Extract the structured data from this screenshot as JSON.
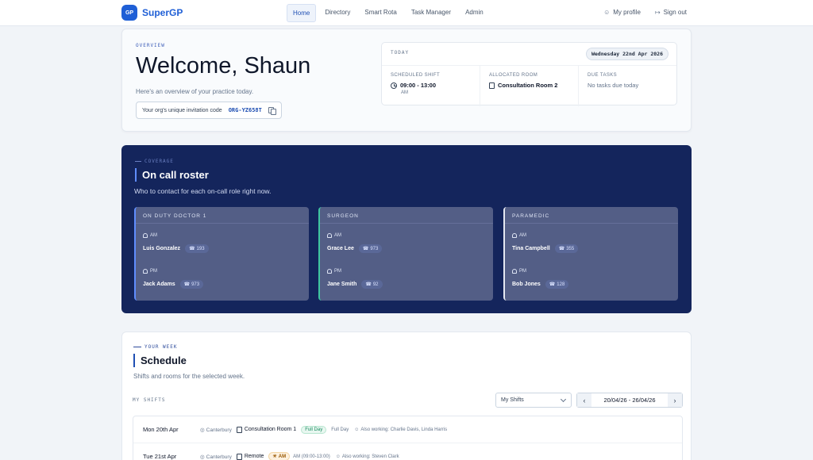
{
  "nav": {
    "logo_badge": "GP",
    "brand": "SuperGP",
    "links": [
      "Home",
      "Directory",
      "Smart Rota",
      "Task Manager",
      "Admin"
    ],
    "my_profile": "My profile",
    "sign_out": "Sign out"
  },
  "overview": {
    "eyebrow": "OVERVIEW",
    "welcome": "Welcome, Shaun",
    "subtitle": "Here's an overview of your practice today.",
    "invite_label": "Your org's unique invitation code",
    "invite_code": "ORG-YZ658T"
  },
  "today": {
    "heading": "TODAY",
    "date": "Wednesday 22nd Apr 2026",
    "scheduled_label": "SCHEDULED SHIFT",
    "scheduled_time": "09:00 - 13:00",
    "scheduled_period": "AM",
    "room_label": "ALLOCATED ROOM",
    "room_value": "Consultation Room 2",
    "tasks_label": "DUE TASKS",
    "tasks_value": "No tasks due today"
  },
  "roster": {
    "eyebrow": "COVERAGE",
    "title": "On call roster",
    "subtitle": "Who to contact for each on-call role right now.",
    "roles": [
      {
        "title": "ON DUTY DOCTOR 1",
        "am_label": "AM",
        "am_name": "Luis Gonzalez",
        "am_ext": "193",
        "pm_label": "PM",
        "pm_name": "Jack Adams",
        "pm_ext": "973"
      },
      {
        "title": "SURGEON",
        "am_label": "AM",
        "am_name": "Grace Lee",
        "am_ext": "973",
        "pm_label": "PM",
        "pm_name": "Jane Smith",
        "pm_ext": "92"
      },
      {
        "title": "PARAMEDIC",
        "am_label": "AM",
        "am_name": "Tina Campbell",
        "am_ext": "355",
        "pm_label": "PM",
        "pm_name": "Bob Jones",
        "pm_ext": "128"
      }
    ]
  },
  "schedule": {
    "eyebrow": "YOUR WEEK",
    "title": "Schedule",
    "subtitle": "Shifts and rooms for the selected week.",
    "my_shifts_label": "MY SHIFTS",
    "filter_value": "My Shifts",
    "prev": "‹",
    "next": "›",
    "week_range": "20/04/26 - 26/04/26",
    "rows": [
      {
        "day": "Mon 20th Apr",
        "location": "Canterbury",
        "room": "Consultation Room 1",
        "badge": "Full Day",
        "shift_text": "Full Day",
        "also": "Also working: Charlie Davis, Linda Harris"
      },
      {
        "day": "Tue 21st Apr",
        "location": "Canterbury",
        "room": "Remote",
        "badge": "AM",
        "shift_text": "AM (09:00-13:00)",
        "also": "Also working: Steven Clark"
      }
    ]
  }
}
